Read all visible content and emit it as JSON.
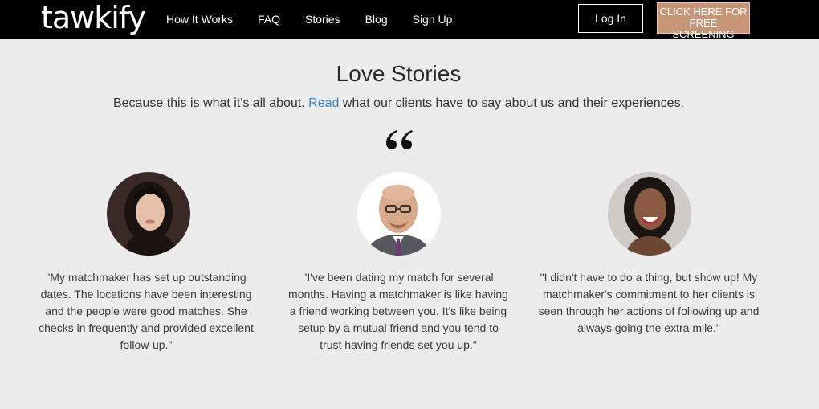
{
  "brand": {
    "logo_text": "tawkify"
  },
  "nav": {
    "links": [
      "How It Works",
      "FAQ",
      "Stories",
      "Blog",
      "Sign Up"
    ],
    "login_label": "Log In",
    "cta_line1": "CLICK HERE FOR",
    "cta_line2": "FREE SCREENING"
  },
  "section": {
    "title": "Love Stories",
    "subtitle_before": "Because this is what it's all about. ",
    "subtitle_link": "Read",
    "subtitle_after": " what our clients have to say about us and their experiences."
  },
  "testimonials": [
    {
      "quote": "\"My matchmaker has set up outstanding dates. The locations have been interesting and the people were good matches. She checks in frequently and provided excellent follow-up.\""
    },
    {
      "quote": "\"I've been dating my match for several months. Having a matchmaker is like having a friend working between you. It's like being setup by a mutual friend and you tend to trust having friends set you up.\""
    },
    {
      "quote": "\"I didn't have to do a thing, but show up! My matchmaker's commitment to her clients is seen through her actions of following up and always going the extra mile.\""
    }
  ],
  "colors": {
    "navbar": "#000000",
    "link_accent": "#3a87c8",
    "cta": "#c79578",
    "page_bg": "#ececec"
  }
}
